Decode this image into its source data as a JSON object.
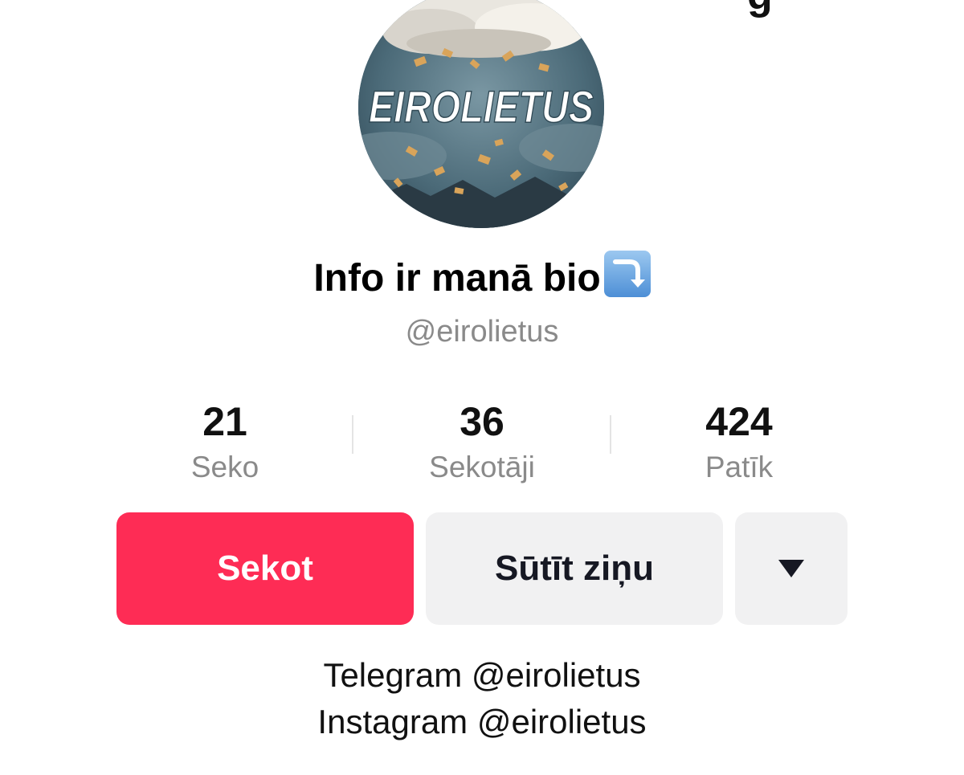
{
  "profile": {
    "avatar_text": "EIROLIETUS",
    "display_name": "Info ir manā bio",
    "name_emoji": "right-arrow-curving-down-icon",
    "username": "@eirolietus"
  },
  "stats": [
    {
      "count": "21",
      "label": "Seko"
    },
    {
      "count": "36",
      "label": "Sekotāji"
    },
    {
      "count": "424",
      "label": "Patīk"
    }
  ],
  "actions": {
    "follow_label": "Sekot",
    "message_label": "Sūtīt ziņu",
    "more_icon": "caret-down-icon"
  },
  "bio": {
    "lines": [
      "Telegram @eirolietus",
      "Instagram @eirolietus"
    ]
  },
  "colors": {
    "follow": "#fe2c55",
    "secondary_button": "#f1f1f2",
    "muted_text": "#8a8a8a"
  }
}
